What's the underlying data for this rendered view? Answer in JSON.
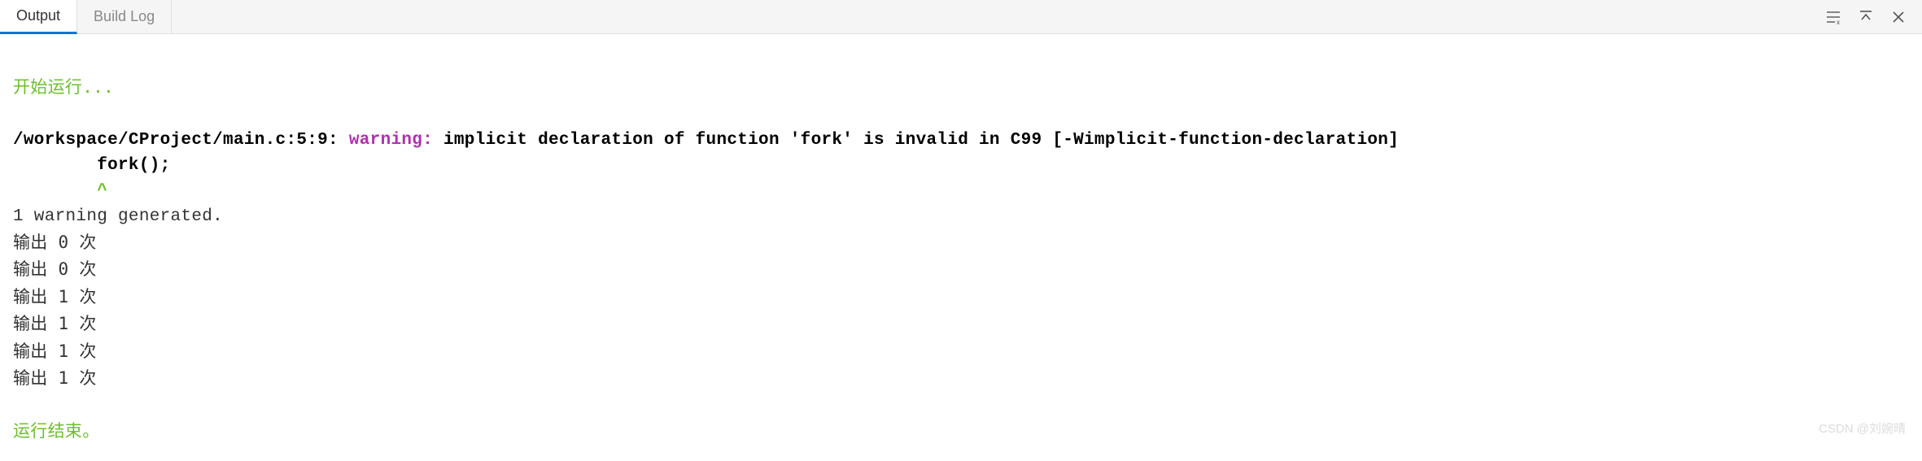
{
  "tabs": {
    "output": "Output",
    "build_log": "Build Log"
  },
  "messages": {
    "start": "开始运行...",
    "end": "运行结束。"
  },
  "warning": {
    "location": "/workspace/CProject/main.c:5:9: ",
    "label": "warning:",
    "text": " implicit declaration of function 'fork' is invalid in C99 [-Wimplicit-function-declaration]",
    "code_line": "        fork();",
    "caret_line": "        ^"
  },
  "summary": "1 warning generated.",
  "outputs": [
    "输出 0 次",
    "输出 0 次",
    "输出 1 次",
    "输出 1 次",
    "输出 1 次",
    "输出 1 次"
  ],
  "watermark": "CSDN @刘婉晴"
}
